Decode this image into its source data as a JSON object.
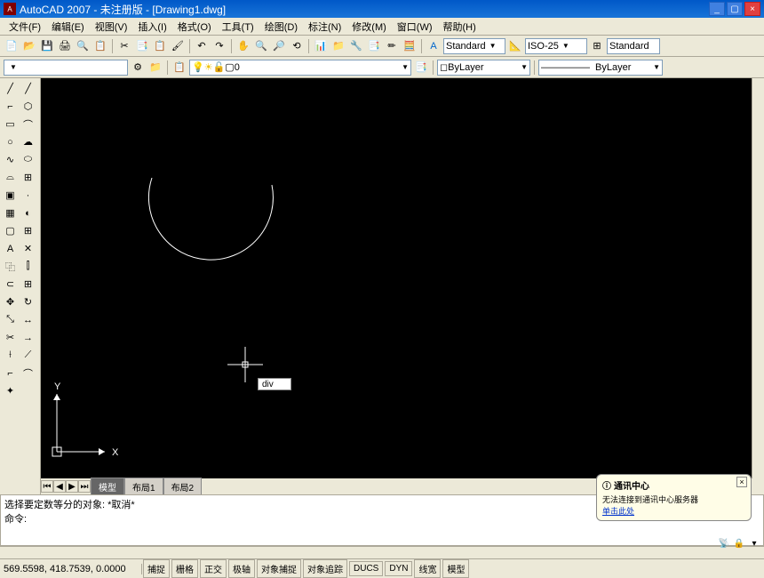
{
  "title": "AutoCAD 2007 - 未注册版 - [Drawing1.dwg]",
  "menu": [
    "文件(F)",
    "编辑(E)",
    "视图(V)",
    "插入(I)",
    "格式(O)",
    "工具(T)",
    "绘图(D)",
    "标注(N)",
    "修改(M)",
    "窗口(W)",
    "帮助(H)"
  ],
  "styles": {
    "text_style": "Standard",
    "dim_style": "ISO-25",
    "table_style": "Standard"
  },
  "layer": {
    "current": "0",
    "color": "ByLayer",
    "linetype": "ByLayer"
  },
  "tabs": {
    "model": "模型",
    "layout1": "布局1",
    "layout2": "布局2"
  },
  "cmd_input": "div",
  "command": {
    "line1": "选择要定数等分的对象: *取消*",
    "line2": "命令:"
  },
  "status": {
    "coords": "569.5598, 418.7539, 0.0000",
    "toggles": [
      "捕捉",
      "栅格",
      "正交",
      "极轴",
      "对象捕捉",
      "对象追踪",
      "DUCS",
      "DYN",
      "线宽",
      "模型"
    ]
  },
  "notif": {
    "title": "通讯中心",
    "body": "无法连接到通讯中心服务器",
    "link": "单击此处"
  },
  "axes": {
    "x": "X",
    "y": "Y"
  }
}
